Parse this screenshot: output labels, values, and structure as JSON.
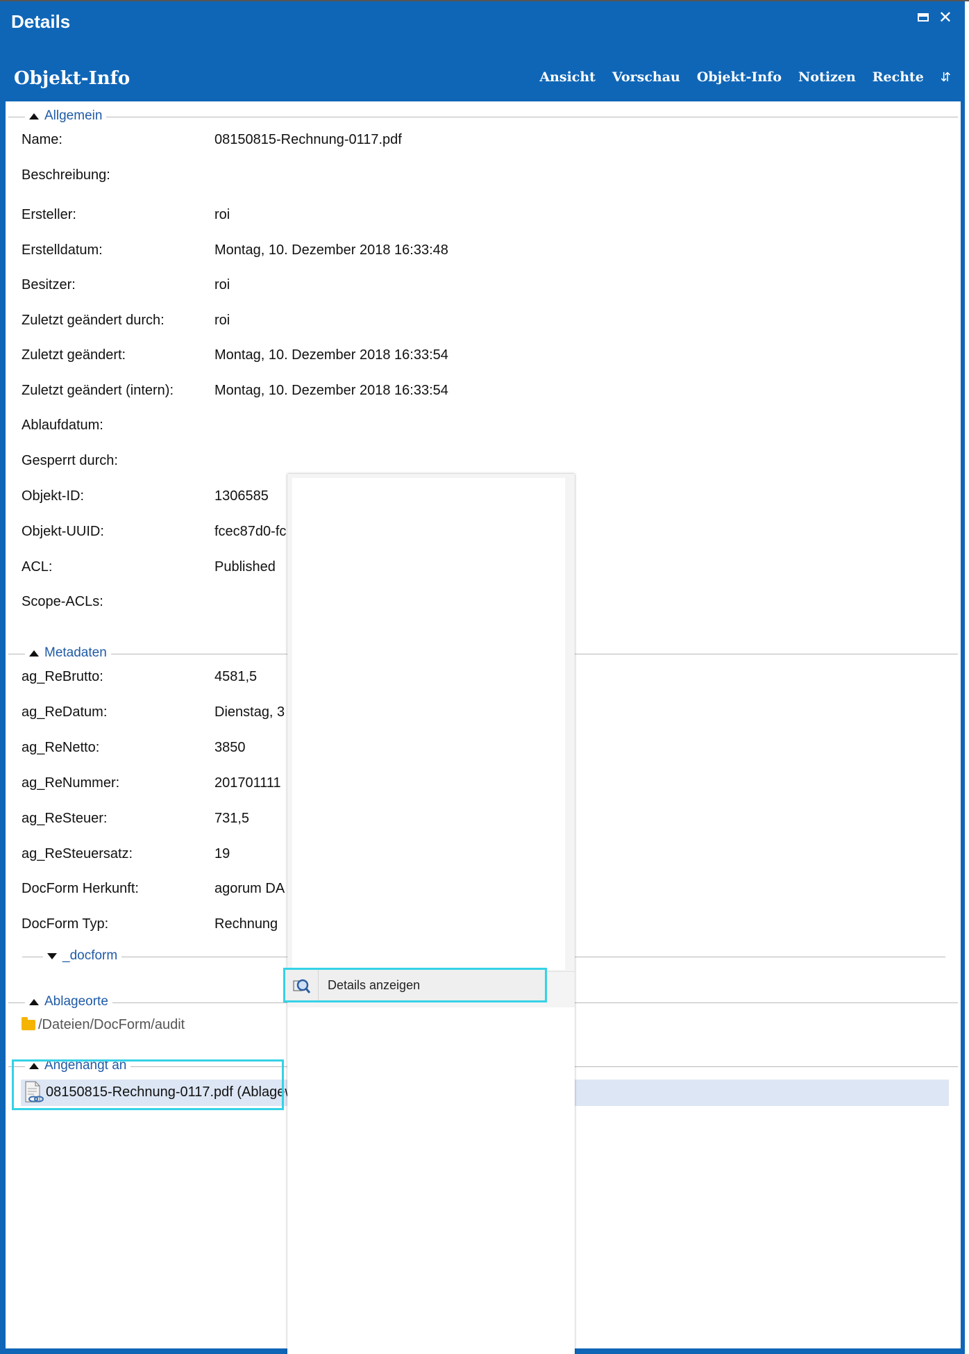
{
  "window": {
    "title": "Details"
  },
  "panel": {
    "title": "Objekt-Info"
  },
  "tabs": [
    "Ansicht",
    "Vorschau",
    "Objekt-Info",
    "Notizen",
    "Rechte"
  ],
  "sections": {
    "allgemein": "Allgemein",
    "metadaten": "Metadaten",
    "docform": "_docform",
    "ablageorte": "Ablageorte",
    "angehaengt": "Angehängt an"
  },
  "allgemein_fields": [
    {
      "label": "Name:",
      "value": "08150815-Rechnung-0117.pdf"
    },
    {
      "label": "Beschreibung:",
      "value": ""
    },
    {
      "label": "Ersteller:",
      "value": "roi"
    },
    {
      "label": "Erstelldatum:",
      "value": "Montag, 10. Dezember 2018 16:33:48"
    },
    {
      "label": "Besitzer:",
      "value": "roi"
    },
    {
      "label": "Zuletzt geändert durch:",
      "value": "roi"
    },
    {
      "label": "Zuletzt geändert:",
      "value": "Montag, 10. Dezember 2018 16:33:54"
    },
    {
      "label": "Zuletzt geändert (intern):",
      "value": "Montag, 10. Dezember 2018 16:33:54"
    },
    {
      "label": "Ablaufdatum:",
      "value": ""
    },
    {
      "label": "Gesperrt durch:",
      "value": ""
    },
    {
      "label": "Objekt-ID:",
      "value": "1306585"
    },
    {
      "label": "Objekt-UUID:",
      "value": "fcec87d0-fc"
    },
    {
      "label": "ACL:",
      "value": "Published"
    },
    {
      "label": "Scope-ACLs:",
      "value": ""
    }
  ],
  "metadaten_fields": [
    {
      "label": "ag_ReBrutto:",
      "value": "4581,5"
    },
    {
      "label": "ag_ReDatum:",
      "value": "Dienstag, 3"
    },
    {
      "label": "ag_ReNetto:",
      "value": "3850"
    },
    {
      "label": "ag_ReNummer:",
      "value": "201701111"
    },
    {
      "label": "ag_ReSteuer:",
      "value": "731,5"
    },
    {
      "label": "ag_ReSteuersatz:",
      "value": "19"
    },
    {
      "label": "DocForm Herkunft:",
      "value": "agorum DA"
    },
    {
      "label": "DocForm Typ:",
      "value": "Rechnung"
    }
  ],
  "ablageorte": {
    "path": "/Dateien/DocForm/audit"
  },
  "attached": {
    "text": "08150815-Rechnung-0117.pdf (Ablagew"
  },
  "context_menu": {
    "item": "Details anzeigen"
  },
  "colors": {
    "header": "#0f66b7",
    "section_label": "#1f5aa6",
    "highlight": "#35d2e6",
    "selected_row": "#dde6f4"
  }
}
